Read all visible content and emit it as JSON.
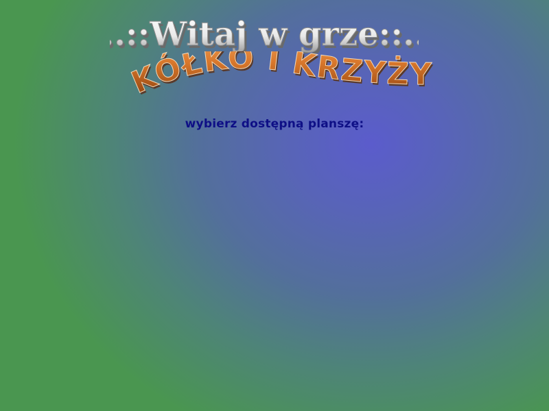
{
  "header": {
    "welcome_text": "..::Witaj w grze::..",
    "game_title": "KÓŁKO I KRZYŻYK"
  },
  "prompt": {
    "choose_board": "wybierz dostępną planszę:"
  },
  "boards": [],
  "colors": {
    "welcome_fill": "#f4f4f4",
    "welcome_shadow": "#7a7a7a",
    "title_fill_top": "#f2a056",
    "title_fill_bottom": "#8a3e0c",
    "prompt_text": "#0e0f86",
    "background_center": "#5b5ccc",
    "background_edge": "#4a9650"
  }
}
